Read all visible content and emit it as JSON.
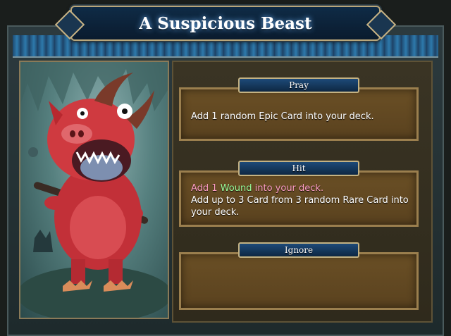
{
  "event": {
    "title": "A Suspicious Beast"
  },
  "portrait": {
    "subject": "red-pig-demon"
  },
  "options": [
    {
      "label": "Pray",
      "description": "Add 1 random Epic Card into your deck."
    },
    {
      "label": "Hit",
      "penalty": {
        "prefix": "Add 1",
        "keyword": "Wound",
        "suffix": "into your deck."
      },
      "description": "Add up to 3 Card from 3 random Rare Card into your deck."
    },
    {
      "label": "Ignore",
      "description": ""
    }
  ],
  "colors": {
    "penalty_text": "#ff9fc4",
    "keyword_text": "#9cff9c",
    "tab_blue": "#1d4a78",
    "option_bg": "#5a421f"
  }
}
